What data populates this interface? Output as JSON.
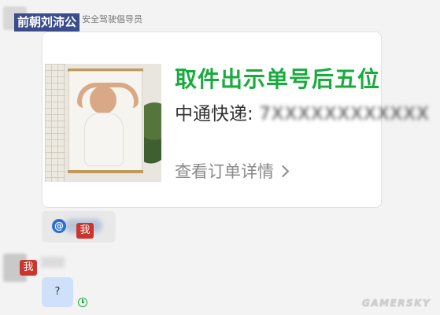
{
  "message1": {
    "sender_name": "前朝刘沛公",
    "sender_title": "安全驾驶倡导员",
    "card": {
      "headline": "取件出示单号后五位",
      "courier_label": "中通快递: ",
      "tracking_number_blurred": "7XXXXXXXXXXXX",
      "view_order_label": "查看订单详情"
    }
  },
  "mention_message": {
    "at_symbol": "@",
    "badge_text": "我"
  },
  "message2": {
    "avatar_badge": "我",
    "bubble_text": "?",
    "status": "sent-clock-icon"
  },
  "watermark": "GAMERSKY",
  "colors": {
    "headline_green": "#1aab3e",
    "name_tag_bg": "#3a4d8a",
    "badge_red": "#c8362e",
    "self_bubble": "#cfe0fb"
  }
}
